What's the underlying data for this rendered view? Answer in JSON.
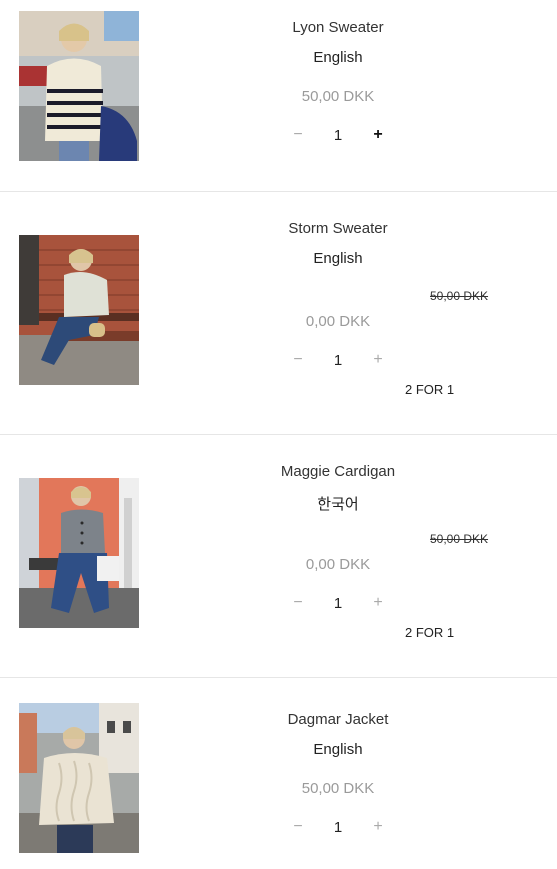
{
  "items": [
    {
      "title": "Lyon Sweater",
      "language": "English",
      "price": "50,00 DKK",
      "quantity": "1",
      "minus": "−",
      "plus": "+",
      "image": "woman-striped-sweater-photo"
    },
    {
      "title": "Storm Sweater",
      "language": "English",
      "old_price": "50,00 DKK",
      "price": "0,00 DKK",
      "quantity": "1",
      "minus": "−",
      "plus": "+",
      "promo": "2 FOR 1",
      "image": "woman-on-bench-photo"
    },
    {
      "title": "Maggie Cardigan",
      "language": "한국어",
      "old_price": "50,00 DKK",
      "price": "0,00 DKK",
      "quantity": "1",
      "minus": "−",
      "plus": "+",
      "promo": "2 FOR 1",
      "image": "woman-grey-cardigan-photo"
    },
    {
      "title": "Dagmar Jacket",
      "language": "English",
      "price": "50,00 DKK",
      "quantity": "1",
      "minus": "−",
      "plus": "+",
      "image": "woman-cable-knit-jacket-photo"
    }
  ]
}
